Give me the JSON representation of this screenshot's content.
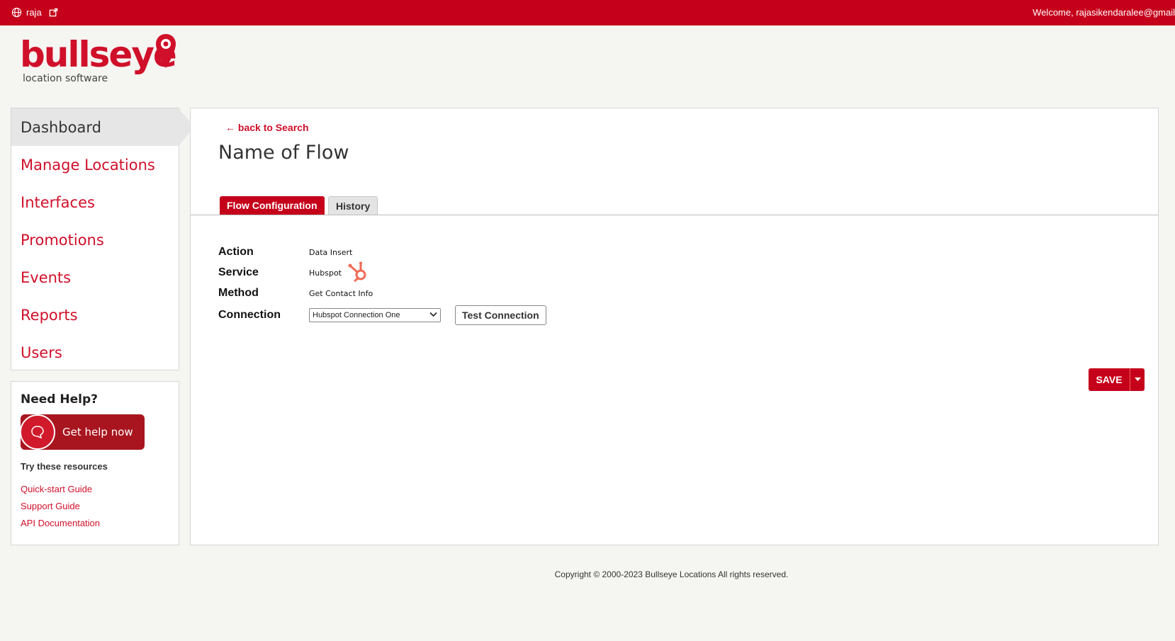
{
  "topbar": {
    "user": "raja",
    "welcome": "Welcome, rajasikendaralee@gmail",
    "globe_icon": "globe-icon",
    "external_icon": "external-link-icon"
  },
  "logo": {
    "name": "bullseye",
    "tagline": "location software"
  },
  "sidebar": {
    "items": [
      {
        "label": "Dashboard",
        "active": true
      },
      {
        "label": "Manage Locations"
      },
      {
        "label": "Interfaces"
      },
      {
        "label": "Promotions"
      },
      {
        "label": "Events"
      },
      {
        "label": "Reports"
      },
      {
        "label": "Users"
      }
    ]
  },
  "help": {
    "title": "Need Help?",
    "button": "Get help now",
    "resources_title": "Try these resources",
    "links": [
      "Quick-start Guide",
      "Support Guide",
      "API Documentation"
    ]
  },
  "main": {
    "back_link": "back to Search",
    "title": "Name of Flow",
    "tabs": [
      "Flow Configuration",
      "History"
    ],
    "fields": {
      "action_label": "Action",
      "action_value": "Data Insert",
      "service_label": "Service",
      "service_value": "Hubspot",
      "method_label": "Method",
      "method_value": "Get Contact Info",
      "connection_label": "Connection",
      "connection_value": "Hubspot Connection One"
    },
    "test_button": "Test Connection",
    "save_button": "SAVE"
  },
  "footer": {
    "copyright": "Copyright © 2000-2023 Bullseye Locations All rights reserved."
  },
  "colors": {
    "brand": "#c5001a",
    "link": "#d0102a"
  }
}
